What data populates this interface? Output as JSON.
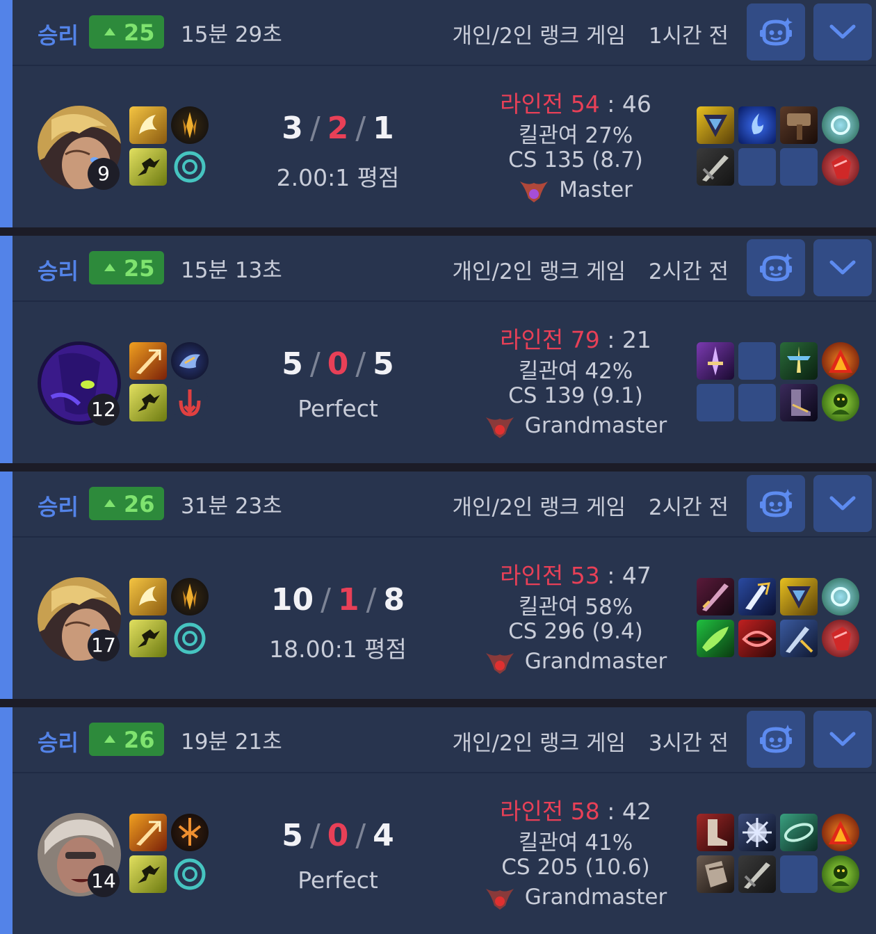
{
  "games": [
    {
      "result": "승리",
      "lp": "25",
      "duration": "15분 29초",
      "queue": "개인/2인 랭크 게임",
      "ago": "1시간 전",
      "level": "9",
      "kills": "3",
      "deaths": "2",
      "assists": "1",
      "ratio": "2.00:1 평점",
      "lane_label": "라인전",
      "lane_win": "54",
      "lane_sep": ":",
      "lane_loss": "46",
      "kill_part": "킬관여 27%",
      "cs": "CS 135 (8.7)",
      "tier": "Master",
      "champion_icon": "ezreal-portrait",
      "accent_color": "#5383e8"
    },
    {
      "result": "승리",
      "lp": "25",
      "duration": "15분 13초",
      "queue": "개인/2인 랭크 게임",
      "ago": "2시간 전",
      "level": "12",
      "kills": "5",
      "deaths": "0",
      "assists": "5",
      "ratio": "Perfect",
      "lane_label": "라인전",
      "lane_win": "79",
      "lane_sep": ":",
      "lane_loss": "21",
      "kill_part": "킬관여 42%",
      "cs": "CS 139 (9.1)",
      "tier": "Grandmaster",
      "champion_icon": "kassadin-portrait",
      "accent_color": "#5383e8"
    },
    {
      "result": "승리",
      "lp": "26",
      "duration": "31분 23초",
      "queue": "개인/2인 랭크 게임",
      "ago": "2시간 전",
      "level": "17",
      "kills": "10",
      "deaths": "1",
      "assists": "8",
      "ratio": "18.00:1 평점",
      "lane_label": "라인전",
      "lane_win": "53",
      "lane_sep": ":",
      "lane_loss": "47",
      "kill_part": "킬관여 58%",
      "cs": "CS 296 (9.4)",
      "tier": "Grandmaster",
      "champion_icon": "ezreal-portrait",
      "accent_color": "#5383e8"
    },
    {
      "result": "승리",
      "lp": "26",
      "duration": "19분 21초",
      "queue": "개인/2인 랭크 게임",
      "ago": "3시간 전",
      "level": "14",
      "kills": "5",
      "deaths": "0",
      "assists": "4",
      "ratio": "Perfect",
      "lane_label": "라인전",
      "lane_win": "58",
      "lane_sep": ":",
      "lane_loss": "42",
      "kill_part": "킬관여 41%",
      "cs": "CS 205 (10.6)",
      "tier": "Grandmaster",
      "champion_icon": "senna-portrait",
      "accent_color": "#5383e8"
    }
  ],
  "kda_separator": "/",
  "colors": {
    "win": "#5383e8",
    "lp_bg": "#2d8a3b",
    "lp_text": "#7fe36f",
    "deaths": "#e84057",
    "card_bg": "#28344e"
  }
}
